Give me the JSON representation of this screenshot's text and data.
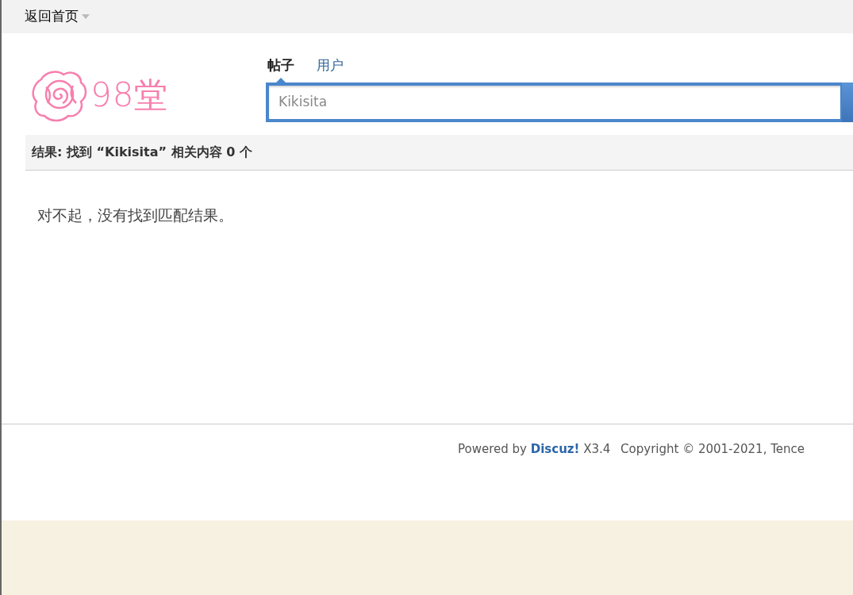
{
  "top_bar": {
    "home_link": "返回首页"
  },
  "logo": {
    "text": "98堂"
  },
  "search": {
    "tabs": [
      {
        "label": "帖子",
        "selected": true
      },
      {
        "label": "用户",
        "selected": false
      }
    ],
    "value": "Kikisita"
  },
  "results": {
    "summary": "结果: 找到 “Kikisita” 相关内容 0 个",
    "message": "对不起，没有找到匹配结果。"
  },
  "footer": {
    "powered_prefix": "Powered by",
    "powered_link": "Discuz!",
    "version": "X3.4",
    "copyright": "Copyright © 2001-2021, Tence"
  }
}
